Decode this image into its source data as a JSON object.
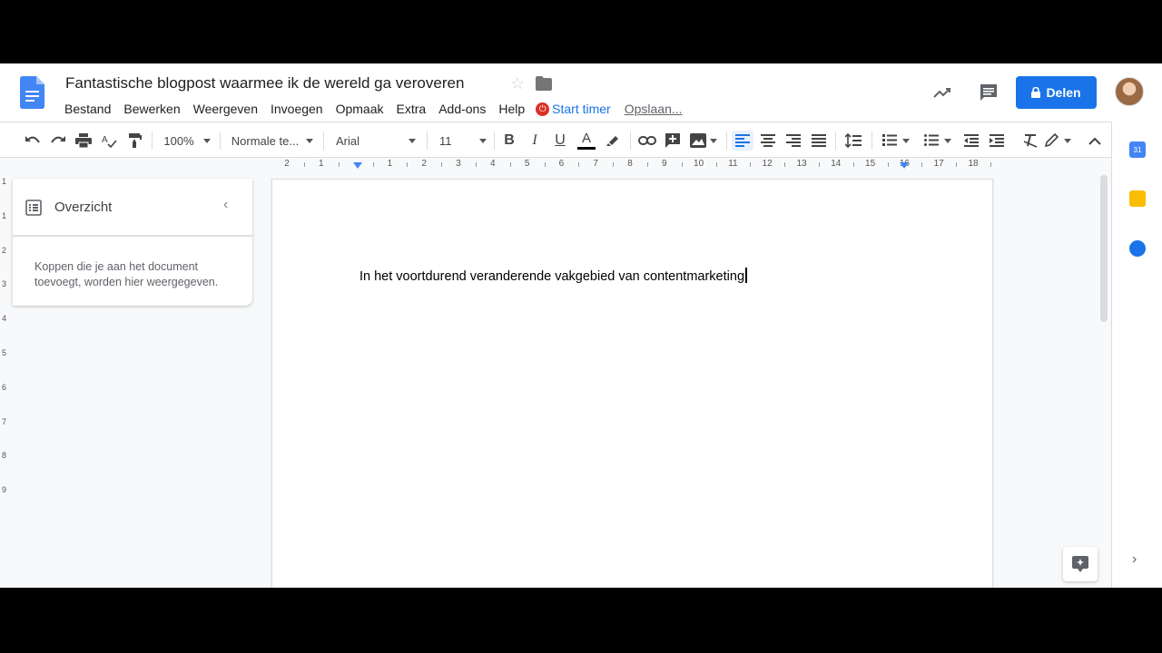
{
  "header": {
    "doc_title": "Fantastische blogpost waarmee ik de wereld ga veroveren",
    "menus": [
      "Bestand",
      "Bewerken",
      "Weergeven",
      "Invoegen",
      "Opmaak",
      "Extra",
      "Add-ons",
      "Help"
    ],
    "timer_label": "Start timer",
    "save_status": "Opslaan...",
    "share_label": "Delen"
  },
  "toolbar": {
    "zoom": "100%",
    "style": "Normale te...",
    "font": "Arial",
    "font_size": "11"
  },
  "ruler": {
    "labels": [
      "2",
      "1",
      "",
      "1",
      "2",
      "3",
      "4",
      "5",
      "6",
      "7",
      "8",
      "9",
      "10",
      "11",
      "12",
      "13",
      "14",
      "15",
      "16",
      "17",
      "18"
    ]
  },
  "vruler": {
    "labels": [
      "1",
      "1",
      "2",
      "3",
      "4",
      "5",
      "6",
      "7",
      "8",
      "9"
    ]
  },
  "outline": {
    "title": "Overzicht",
    "hint": "Koppen die je aan het document toevoegt, worden hier weergegeven."
  },
  "document": {
    "text": "In het voortdurend veranderende vakgebied van contentmarketing"
  },
  "sidepanel": {
    "calendar_label": "31"
  },
  "colors": {
    "accent": "#1a73e8",
    "timer_red": "#d93025"
  }
}
